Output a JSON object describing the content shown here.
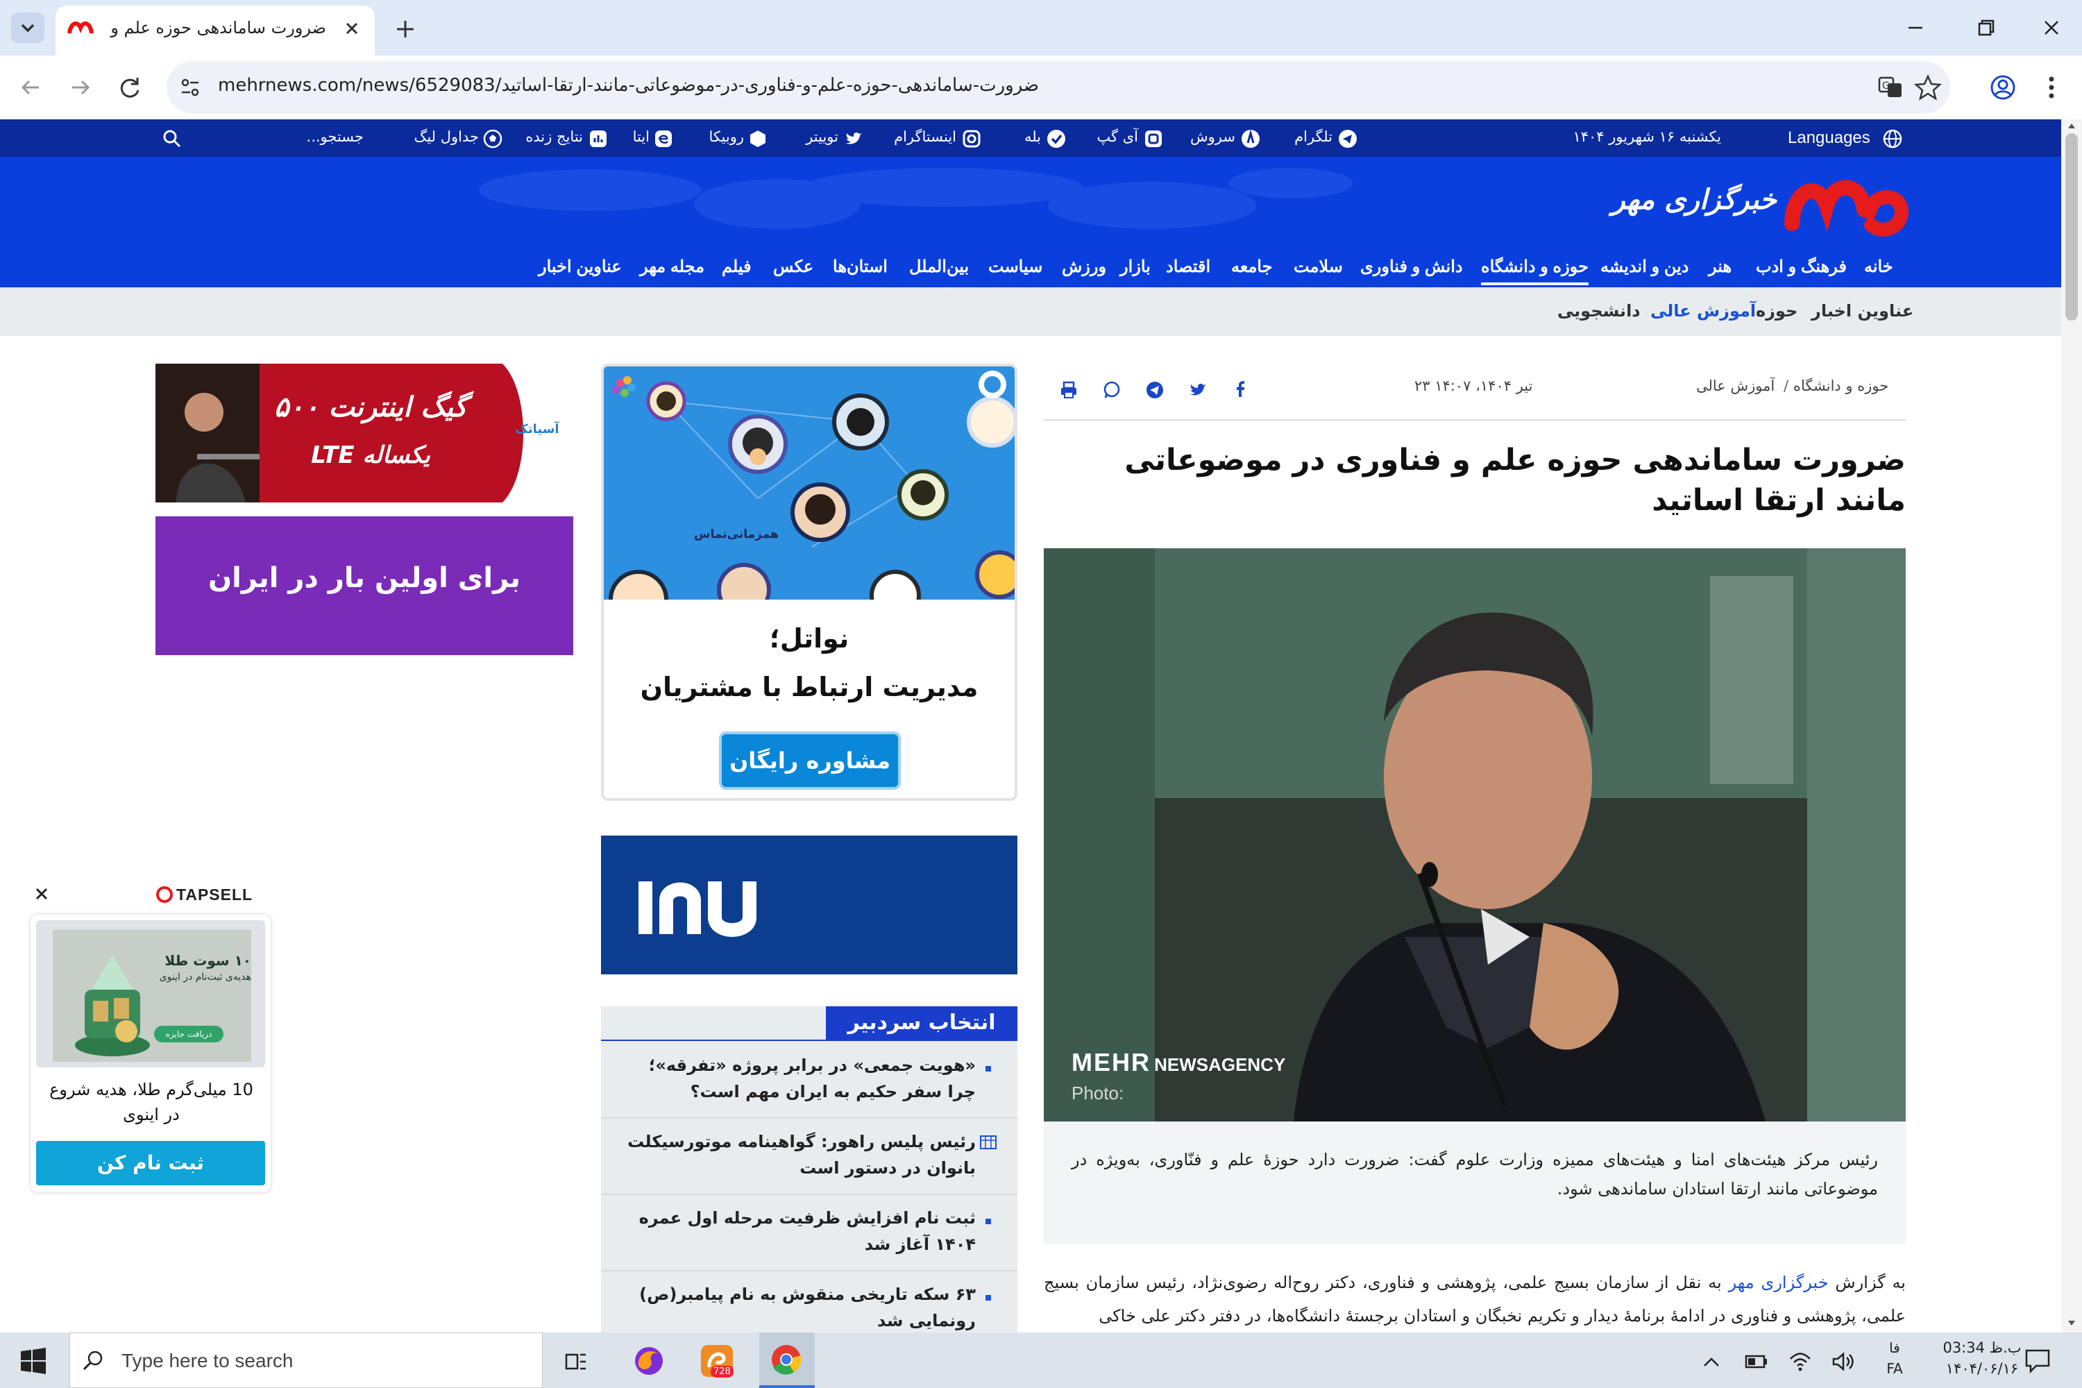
{
  "browser": {
    "tab_title": "ضرورت ساماندهی حوزه علم و فنا",
    "url": "mehrnews.com/news/6529083/ضرورت-ساماندهی-حوزه-علم-و-فناوری-در-موضوعاتی-مانند-ارتقا-اساتید"
  },
  "site": {
    "logo_text": "خبرگزاری مهر",
    "languages": "Languages",
    "date": "یکشنبه ۱۶ شهریور ۱۴۰۴",
    "social": [
      "تلگرام",
      "سروش",
      "آی گپ",
      "بله",
      "اینستاگرام",
      "توییتر",
      "روبیکا",
      "ایتا",
      "نتایج زنده",
      "جداول لیگ"
    ],
    "search_placeholder": "جستجو...",
    "nav": [
      "خانه",
      "فرهنگ و ادب",
      "هنر",
      "دین و اندیشه",
      "حوزه و دانشگاه",
      "دانش و فناوری",
      "سلامت",
      "جامعه",
      "اقتصاد",
      "بازار",
      "ورزش",
      "سیاست",
      "بین‌الملل",
      "استان‌ها",
      "عکس",
      "فیلم",
      "مجله مهر",
      "عناوین اخبار"
    ],
    "subnav": [
      "عناوین اخبار",
      "حوزه",
      "آموزش عالی",
      "دانشجویی"
    ],
    "active_nav": "حوزه و دانشگاه",
    "active_subnav": "آموزش عالی"
  },
  "article": {
    "breadcrumb_1": "حوزه و دانشگاه",
    "breadcrumb_sep": "/",
    "breadcrumb_2": "آموزش عالی",
    "datetime": "۲۳ تیر ۱۴۰۴، ۱۴:۰۷",
    "title": "ضرورت ساماندهی حوزه علم و فناوری در موضوعاتی مانند ارتقا اساتید",
    "photo_watermark_bold": "MEHR",
    "photo_watermark": "NEWSAGENCY",
    "photo_label": "Photo:",
    "lead": "رئیس مرکز هیئت‌های امنا و هیئت‌های ممیزه وزارت علوم گفت: ضرورت دارد حوزهٔ علم و فنّاوری، به‌ویژه در موضوعاتی مانند ارتقا استادان ساماندهی شود.",
    "body_prefix": "به گزارش ",
    "body_link": "خبرگزاری مهر",
    "body_rest": " به نقل از سازمان بسیج علمی، پژوهشی و فناوری، دکتر روح‌اله رضوی‌نژاد، رئیس سازمان بسیج علمی، پژوهشی و فناوری در ادامهٔ برنامهٔ دیدار و تکریم نخبگان و استادان برجستهٔ دانشگاه‌ها، در دفتر دکتر علی خاکی"
  },
  "ads": {
    "lte_big": "۵۰۰ گیگ اینترنت",
    "lte_small": "LTE یکساله",
    "lte_brand": "آسیاتک",
    "purple": "برای اولین بار در ایران",
    "navatel_label": "همزمانی‌تماس",
    "navatel_title": "نواتل؛",
    "navatel_sub": "مدیریت ارتباط با مشتریان",
    "navatel_btn": "مشاوره رایگان"
  },
  "editor_pick": {
    "heading": "انتخاب سردبیر",
    "items": [
      "«هویت جمعی» در برابر پروژه «تفرقه»؛ چرا سفر حکیم به ایران مهم است؟",
      "رئیس پلیس راهور: گواهینامه موتورسیکلت بانوان در دستور است",
      "ثبت نام افزایش ظرفیت مرحله اول عمره ۱۴۰۴ آغاز شد",
      "۶۳ سکه تاریخی منقوش به نام پیامبر(ص) رونمایی شد"
    ]
  },
  "tapsell": {
    "brand": "TAPSELL",
    "img_title": "۱۰ سوت طلا",
    "img_sub": "هدیه‌ی ثبت‌نام در اینوی",
    "img_btn": "دریافت جایزه",
    "text": "10 میلی‌گرم طلا، هدیه شروع در اینوی",
    "cta": "ثبت نام کن"
  },
  "taskbar": {
    "search": "Type here to search",
    "time": "03:34 ب.ظ",
    "date": "۱۴۰۴/۰۶/۱۶",
    "lang_top": "فا",
    "lang": "FA",
    "badge": "728"
  }
}
